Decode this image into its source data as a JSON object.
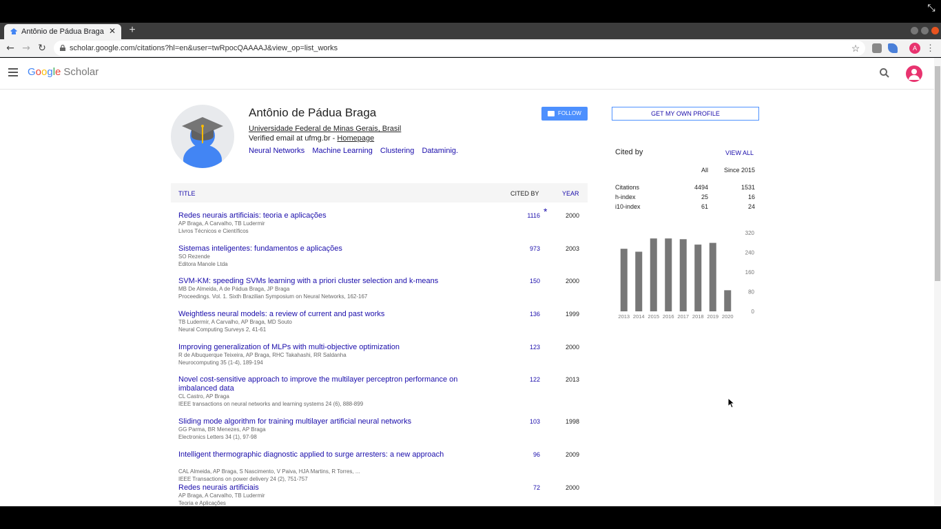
{
  "browser": {
    "tab_title": "Antônio de Pádua Braga",
    "url": "scholar.google.com/citations?hl=en&user=twRpocQAAAAJ&view_op=list_works",
    "profile_initial": "A",
    "new_tab_symbol": "+",
    "close_symbol": "✕"
  },
  "header": {
    "logo_google": "Google",
    "logo_scholar": "Scholar",
    "colors": {
      "blue": "#4285f4",
      "red": "#ea4335",
      "yellow": "#fbbc05",
      "green": "#34a853"
    }
  },
  "profile": {
    "name": "Antônio de Pádua Braga",
    "affiliation": "Universidade Federal de Minas Gerais, Brasil",
    "email_prefix": "Verified email at ufmg.br - ",
    "homepage": "Homepage",
    "tags": [
      "Neural Networks",
      "Machine Learning",
      "Clustering",
      "Dataminig."
    ],
    "follow_label": "FOLLOW"
  },
  "table": {
    "col_title": "TITLE",
    "col_cited": "CITED BY",
    "col_year": "YEAR",
    "rows": [
      {
        "title": "Redes neurais artificiais: teoria e aplicações",
        "authors": "AP Braga, A Carvalho, TB Ludermir",
        "venue": "Livros Técnicos e Científicos",
        "cited": "1116",
        "star": "*",
        "year": "2000"
      },
      {
        "title": "Sistemas inteligentes: fundamentos e aplicações",
        "authors": "SO Rezende",
        "venue": "Editora Manole Ltda",
        "cited": "973",
        "year": "2003"
      },
      {
        "title": "SVM-KM: speeding SVMs learning with a priori cluster selection and k-means",
        "authors": "MB De Almeida, A de Pádua Braga, JP Braga",
        "venue": "Proceedings. Vol. 1. Sixth Brazilian Symposium on Neural Networks, 162-167",
        "cited": "150",
        "year": "2000"
      },
      {
        "title": "Weightless neural models: a review of current and past works",
        "authors": "TB Ludermir, A Carvalho, AP Braga, MD Souto",
        "venue": "Neural Computing Surveys 2, 41-61",
        "cited": "136",
        "year": "1999"
      },
      {
        "title": "Improving generalization of MLPs with multi-objective optimization",
        "authors": "R de Albuquerque Teixeira, AP Braga, RHC Takahashi, RR Saldanha",
        "venue": "Neurocomputing 35 (1-4), 189-194",
        "cited": "123",
        "year": "2000"
      },
      {
        "title": "Novel cost-sensitive approach to improve the multilayer perceptron performance on imbalanced data",
        "authors": "CL Castro, AP Braga",
        "venue": "IEEE transactions on neural networks and learning systems 24 (6), 888-899",
        "cited": "122",
        "year": "2013"
      },
      {
        "title": "Sliding mode algorithm for training multilayer artificial neural networks",
        "authors": "GG Parma, BR Menezes, AP Braga",
        "venue": "Electronics Letters 34 (1), 97-98",
        "cited": "103",
        "year": "1998"
      },
      {
        "title": "Intelligent thermographic diagnostic applied to surge arresters: a new approach",
        "authors": "CAL Almeida, AP Braga, S Nascimento, V Paiva, HJA Martins, R Torres, ...",
        "venue": "IEEE Transactions on power delivery 24 (2), 751-757",
        "cited": "96",
        "year": "2009"
      },
      {
        "title": "Redes neurais artificiais",
        "authors": "AP Braga, A Carvalho, TB Ludermir",
        "venue": "Teoria e Aplicações",
        "cited": "72",
        "year": "2000"
      }
    ]
  },
  "sidebar": {
    "own_profile_label": "GET MY OWN PROFILE",
    "cited_by_title": "Cited by",
    "view_all": "VIEW ALL",
    "col_all": "All",
    "col_since": "Since 2015",
    "stats": [
      {
        "label": "Citations",
        "all": "4494",
        "since": "1531"
      },
      {
        "label": "h-index",
        "all": "25",
        "since": "16"
      },
      {
        "label": "i10-index",
        "all": "61",
        "since": "24"
      }
    ]
  },
  "chart_data": {
    "type": "bar",
    "categories": [
      "2013",
      "2014",
      "2015",
      "2016",
      "2017",
      "2018",
      "2019",
      "2020"
    ],
    "values": [
      255,
      243,
      297,
      297,
      294,
      272,
      279,
      86
    ],
    "ylim": [
      0,
      320
    ],
    "yticks": [
      "0",
      "80",
      "160",
      "240",
      "320"
    ],
    "bar_color": "#777777",
    "y_axis_side": "right"
  }
}
